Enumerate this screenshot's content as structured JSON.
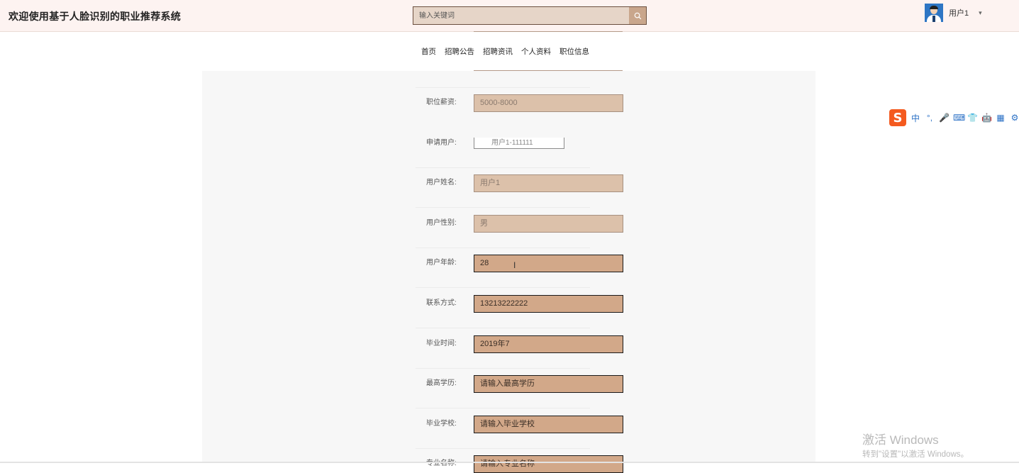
{
  "header": {
    "title": "欢迎使用基于人脸识别的职业推荐系统",
    "search_placeholder": "输入关键词",
    "user_name": "用户1",
    "caret": "▾"
  },
  "nav": {
    "items": [
      "首页",
      "招聘公告",
      "招聘资讯",
      "个人资料",
      "职位信息"
    ]
  },
  "form": {
    "fields": [
      {
        "label": "职位薪资:",
        "value": "5000-8000"
      },
      {
        "label": "申请用户:",
        "value": "用户1-111111"
      },
      {
        "label": "用户姓名:",
        "value": "用户1"
      },
      {
        "label": "用户性别:",
        "value": "男"
      },
      {
        "label": "用户年龄:",
        "value": "28"
      },
      {
        "label": "联系方式:",
        "value": "13213222222"
      },
      {
        "label": "毕业时间:",
        "value": "2019年7"
      },
      {
        "label": "最高学历:",
        "value": "请输入最高学历"
      },
      {
        "label": "毕业学校:",
        "value": "请输入毕业学校"
      },
      {
        "label": "专业名称:",
        "value": "请输入专业名称"
      }
    ]
  },
  "ime": {
    "logo": "S",
    "icons": [
      "中",
      "°,",
      "🎤",
      "⌨",
      "👕",
      "🤖",
      "▦",
      "⚙"
    ]
  },
  "watermark": {
    "line1": "激活 Windows",
    "line2": "转到\"设置\"以激活 Windows。"
  }
}
